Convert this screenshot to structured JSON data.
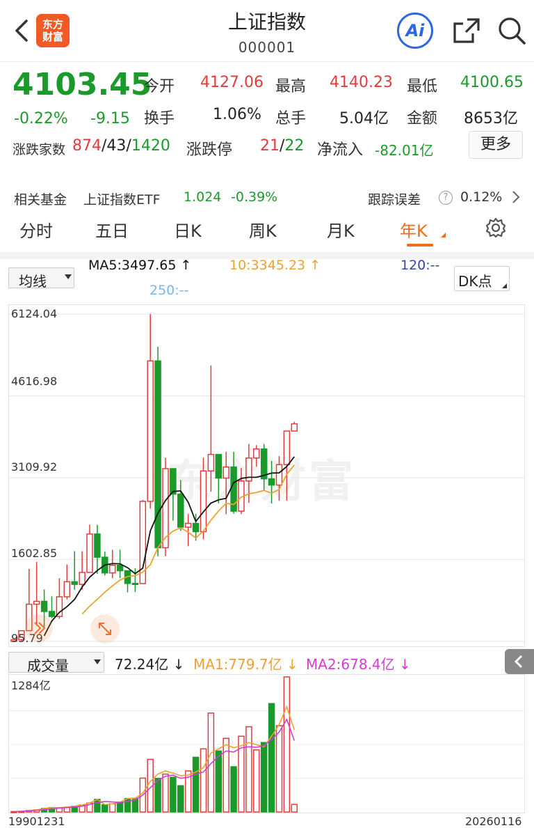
{
  "header": {
    "title": "上证指数",
    "code": "000001",
    "logo_line1": "东方",
    "logo_line2": "财富",
    "ai_label": "Ai"
  },
  "quote": {
    "price": "4103.45",
    "change_pct": "-0.22%",
    "change": "-9.15",
    "open_label": "今开",
    "open": "4127.06",
    "high_label": "最高",
    "high": "4140.23",
    "low_label": "最低",
    "low": "4100.65",
    "turnover_label": "换手",
    "turnover": "1.06%",
    "volume_label": "总手",
    "volume": "5.04亿",
    "amount_label": "金额",
    "amount": "8653亿",
    "breadth_label": "涨跌家数",
    "up": "874",
    "flat": "43",
    "down": "1420",
    "limit_label": "涨跌停",
    "limit_up": "21",
    "limit_down": "22",
    "netflow_label": "净流入",
    "netflow": "-82.01亿",
    "more_label": "更多"
  },
  "fund": {
    "label": "相关基金",
    "name": "上证指数ETF",
    "price": "1.024",
    "pct": "-0.39%",
    "tracking_label": "跟踪误差",
    "tracking_value": "0.12%"
  },
  "tabs": [
    "分时",
    "五日",
    "日K",
    "周K",
    "月K",
    "年K"
  ],
  "active_tab": "年K",
  "ma": {
    "selector": "均线",
    "ma5": "MA5:3497.65",
    "ma10": "10:3345.23",
    "ma120": "120:--",
    "ma250": "250:--",
    "dk": "DK点"
  },
  "y_axis": [
    "6124.04",
    "4616.98",
    "3109.92",
    "1602.85",
    "95.79"
  ],
  "volume": {
    "selector": "成交量",
    "value": "72.24亿",
    "ma1": "MA1:779.7亿",
    "ma2": "MA2:678.4亿",
    "max_label": "1284亿"
  },
  "x_axis": {
    "start": "19901231",
    "end": "20260116"
  },
  "watermark": "东方财富",
  "colors": {
    "up": "#e33b3b",
    "down": "#1a9a2a",
    "accent": "#f36b1c",
    "ma5": "#111111",
    "ma10": "#f0a030",
    "ma120": "#3344aa",
    "ma250": "#7ab8e8",
    "vol_ma2": "#d63ad6"
  },
  "chart_data": {
    "type": "candlestick",
    "title": "",
    "x_start": "19901231",
    "x_end": "20260116",
    "y_range": [
      95.79,
      6124.04
    ],
    "candles": [
      {
        "o": 96,
        "c": 127,
        "h": 127,
        "l": 96
      },
      {
        "o": 127,
        "c": 292,
        "h": 292,
        "l": 105
      },
      {
        "o": 293,
        "c": 780,
        "h": 1429,
        "l": 293
      },
      {
        "o": 780,
        "c": 833,
        "h": 1558,
        "l": 386
      },
      {
        "o": 833,
        "c": 647,
        "h": 1052,
        "l": 325
      },
      {
        "o": 647,
        "c": 555,
        "h": 926,
        "l": 524
      },
      {
        "o": 555,
        "c": 917,
        "h": 1258,
        "l": 512
      },
      {
        "o": 917,
        "c": 1194,
        "h": 1510,
        "l": 870
      },
      {
        "o": 1194,
        "c": 1146,
        "h": 1756,
        "l": 1047
      },
      {
        "o": 1146,
        "c": 1366,
        "h": 1756,
        "l": 1047
      },
      {
        "o": 1366,
        "c": 2073,
        "h": 2245,
        "l": 1361
      },
      {
        "o": 2073,
        "c": 1646,
        "h": 2243,
        "l": 1339
      },
      {
        "o": 1646,
        "c": 1357,
        "h": 1749,
        "l": 1311
      },
      {
        "o": 1357,
        "c": 1497,
        "h": 1783,
        "l": 1259
      },
      {
        "o": 1497,
        "c": 1397,
        "h": 1783,
        "l": 1260
      },
      {
        "o": 1397,
        "c": 1163,
        "h": 1400,
        "l": 998
      },
      {
        "o": 1163,
        "c": 1161,
        "h": 1445,
        "l": 1004
      },
      {
        "o": 1161,
        "c": 2675,
        "h": 2698,
        "l": 1161
      },
      {
        "o": 2675,
        "c": 5261,
        "h": 6124,
        "l": 2541
      },
      {
        "o": 5261,
        "c": 1820,
        "h": 5522,
        "l": 1664
      },
      {
        "o": 1820,
        "c": 3277,
        "h": 3478,
        "l": 1664
      },
      {
        "o": 3277,
        "c": 2808,
        "h": 3186,
        "l": 2319
      },
      {
        "o": 2808,
        "c": 2199,
        "h": 3067,
        "l": 2132
      },
      {
        "o": 2199,
        "c": 2269,
        "h": 2444,
        "l": 1849
      },
      {
        "o": 2269,
        "c": 2116,
        "h": 2444,
        "l": 1949
      },
      {
        "o": 2116,
        "c": 3235,
        "h": 3478,
        "l": 1975
      },
      {
        "o": 3235,
        "c": 3539,
        "h": 5178,
        "l": 2851
      },
      {
        "o": 3539,
        "c": 3103,
        "h": 3539,
        "l": 2638
      },
      {
        "o": 3103,
        "c": 3307,
        "h": 3587,
        "l": 2440
      },
      {
        "o": 3307,
        "c": 2494,
        "h": 3587,
        "l": 2449
      },
      {
        "o": 2494,
        "c": 3050,
        "h": 3288,
        "l": 2440
      },
      {
        "o": 3050,
        "c": 3473,
        "h": 3731,
        "l": 2646
      },
      {
        "o": 3473,
        "c": 3639,
        "h": 3709,
        "l": 3312
      },
      {
        "o": 3639,
        "c": 3089,
        "h": 3731,
        "l": 2885
      },
      {
        "o": 3089,
        "c": 2975,
        "h": 3418,
        "l": 2635
      },
      {
        "o": 2975,
        "c": 3351,
        "h": 3509,
        "l": 2689
      },
      {
        "o": 3351,
        "c": 3969,
        "h": 3969,
        "l": 2689
      },
      {
        "o": 3969,
        "c": 4103,
        "h": 4140,
        "l": 4100
      }
    ],
    "ma_line_black": [
      null,
      null,
      null,
      null,
      200,
      470,
      630,
      735,
      868,
      1096,
      1278,
      1400,
      1502,
      1529,
      1524,
      1453,
      1342,
      1444,
      2130,
      2456,
      2691,
      2856,
      2868,
      2658,
      2303,
      2480,
      2643,
      2702,
      2730,
      3017,
      3097,
      3117,
      3118,
      3154,
      3195,
      3200,
      3316,
      3497
    ],
    "ma_line_orange": [
      null,
      null,
      null,
      null,
      null,
      null,
      null,
      null,
      null,
      600,
      745,
      870,
      1002,
      1118,
      1226,
      1290,
      1307,
      1371,
      1507,
      1821,
      2011,
      2128,
      2186,
      2106,
      1999,
      2128,
      2327,
      2497,
      2638,
      2618,
      2752,
      2813,
      2837,
      2876,
      2824,
      2894,
      3171,
      3345
    ],
    "volume_max": 1284,
    "volume_unit": "亿",
    "volumes": [
      4,
      6,
      15,
      20,
      34,
      42,
      41,
      46,
      55,
      66,
      85,
      120,
      70,
      78,
      93,
      128,
      130,
      322,
      500,
      320,
      360,
      330,
      250,
      390,
      520,
      600,
      940,
      580,
      700,
      430,
      720,
      810,
      590,
      660,
      1030,
      820,
      1284,
      72
    ],
    "vol_ma1": [
      4,
      6,
      15,
      20,
      34,
      42,
      41,
      46,
      55,
      66,
      85,
      120,
      70,
      78,
      93,
      128,
      130,
      180,
      290,
      360,
      390,
      370,
      345,
      350,
      380,
      420,
      560,
      600,
      640,
      610,
      630,
      660,
      640,
      620,
      720,
      830,
      1000,
      779.7
    ],
    "vol_ma2": [
      4,
      5,
      10,
      15,
      22,
      30,
      38,
      42,
      48,
      55,
      70,
      90,
      100,
      95,
      90,
      100,
      115,
      160,
      230,
      300,
      340,
      350,
      320,
      330,
      360,
      380,
      460,
      530,
      580,
      570,
      610,
      620,
      615,
      630,
      690,
      760,
      880,
      678.4
    ]
  }
}
